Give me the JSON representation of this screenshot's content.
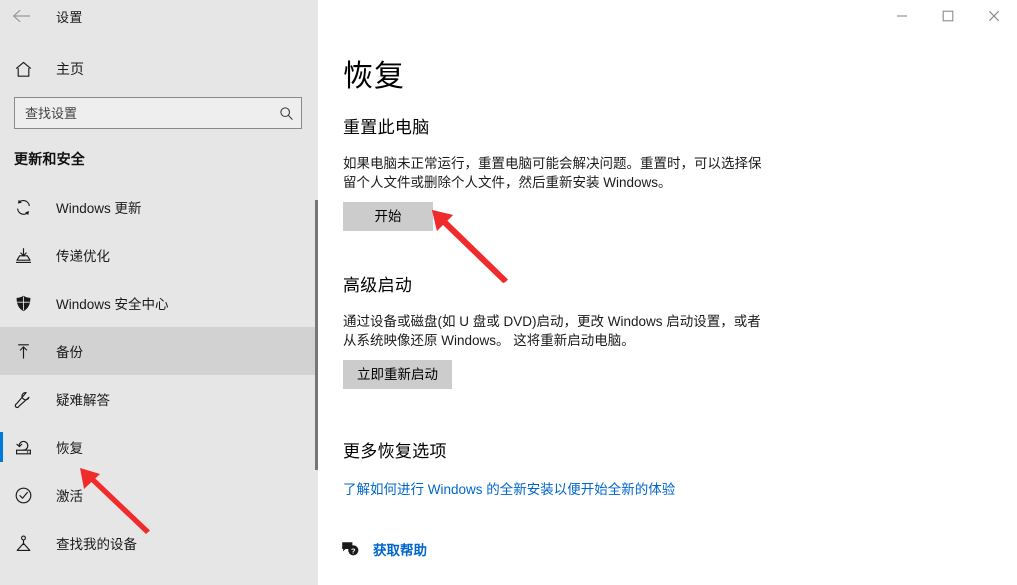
{
  "window": {
    "title": "设置",
    "back_icon": "back-arrow-icon",
    "controls": {
      "minimize": "minimize-icon",
      "maximize": "maximize-icon",
      "close": "close-icon"
    }
  },
  "sidebar": {
    "home": {
      "label": "主页",
      "icon": "home-icon"
    },
    "search": {
      "placeholder": "查找设置",
      "icon": "search-icon"
    },
    "group_title": "更新和安全",
    "items": [
      {
        "label": "Windows 更新",
        "icon": "sync-icon",
        "state": "normal"
      },
      {
        "label": "传递优化",
        "icon": "delivery-optimization-icon",
        "state": "normal"
      },
      {
        "label": "Windows 安全中心",
        "icon": "shield-icon",
        "state": "normal"
      },
      {
        "label": "备份",
        "icon": "backup-upload-icon",
        "state": "hovered"
      },
      {
        "label": "疑难解答",
        "icon": "wrench-icon",
        "state": "normal"
      },
      {
        "label": "恢复",
        "icon": "recovery-icon",
        "state": "selected"
      },
      {
        "label": "激活",
        "icon": "check-circle-icon",
        "state": "normal"
      },
      {
        "label": "查找我的设备",
        "icon": "find-my-device-icon",
        "state": "normal"
      }
    ]
  },
  "main": {
    "page_title": "恢复",
    "sections": [
      {
        "heading": "重置此电脑",
        "body": "如果电脑未正常运行，重置电脑可能会解决问题。重置时，可以选择保留个人文件或删除个人文件，然后重新安装 Windows。",
        "button": "开始"
      },
      {
        "heading": "高级启动",
        "body": "通过设备或磁盘(如 U 盘或 DVD)启动，更改 Windows 启动设置，或者从系统映像还原 Windows。 这将重新启动电脑。",
        "button": "立即重新启动"
      },
      {
        "heading": "更多恢复选项",
        "link": "了解如何进行 Windows 的全新安装以便开始全新的体验"
      }
    ],
    "help": {
      "label": "获取帮助",
      "icon": "help-bubble-icon"
    }
  },
  "annotations": {
    "color": "#f02b2b",
    "arrows": [
      {
        "name": "arrow-to-start-button",
        "target": "开始"
      },
      {
        "name": "arrow-to-recovery-nav",
        "target": "恢复"
      }
    ]
  },
  "colors": {
    "sidebar_bg": "#e6e6e6",
    "content_bg": "#ffffff",
    "accent": "#0078d7",
    "button_bg": "#cccccc",
    "link": "#0066cc",
    "annotation_red": "#f02b2b"
  }
}
